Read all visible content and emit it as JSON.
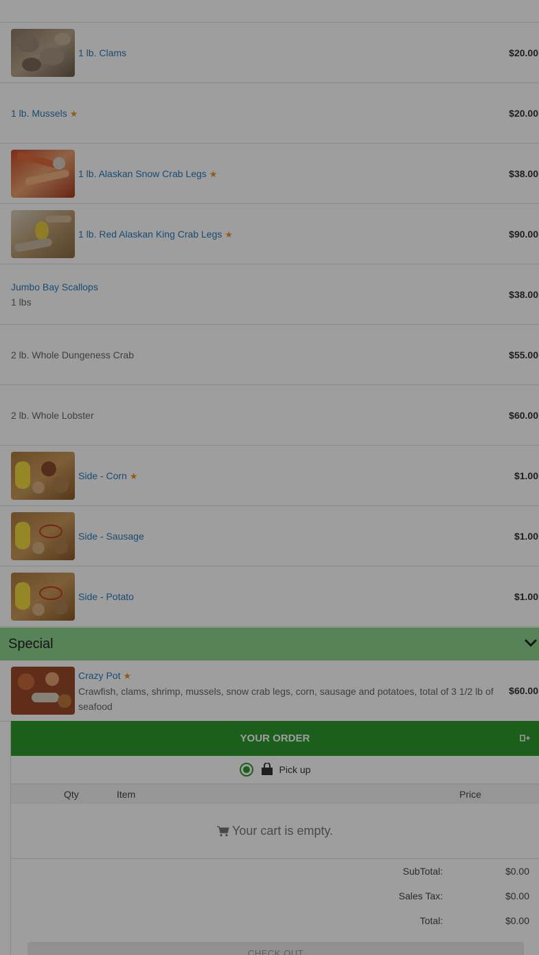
{
  "menu_items": [
    {
      "name": "1 lb. Clams",
      "price": "$20.00",
      "star": false,
      "image": "clams-photo"
    },
    {
      "name": "1 lb. Mussels",
      "price": "$20.00",
      "star": true,
      "image": ""
    },
    {
      "name": "1 lb. Alaskan Snow Crab Legs",
      "price": "$38.00",
      "star": true,
      "image": "snow-crab-photo"
    },
    {
      "name": "1 lb. Red Alaskan King Crab Legs",
      "price": "$90.00",
      "star": true,
      "image": "king-crab-photo"
    },
    {
      "name": "Jumbo Bay Scallops",
      "sub": "1 lbs",
      "price": "$38.00",
      "star": false,
      "image": ""
    },
    {
      "name": "2 lb. Whole Dungeness Crab",
      "price": "$55.00",
      "star": false,
      "image": ""
    },
    {
      "name": "2 lb. Whole Lobster",
      "price": "$60.00",
      "star": false,
      "image": ""
    },
    {
      "name": "Side - Corn",
      "price": "$1.00",
      "star": true,
      "image": "boil-photo"
    },
    {
      "name": "Side - Sausage",
      "price": "$1.00",
      "star": false,
      "image": "boil-photo"
    },
    {
      "name": "Side - Potato",
      "price": "$1.00",
      "star": false,
      "image": "boil-photo"
    }
  ],
  "category": {
    "title": "Special",
    "icon": "chevron-down-icon"
  },
  "special_item": {
    "name": "Crazy Pot",
    "description": "Crawfish, clams, shrimp, mussels, snow crab legs, corn, sausage and potatoes, total of 3 1/2 lb of seafood",
    "price": "$60.00",
    "star": true
  },
  "order": {
    "header": "YOUR ORDER",
    "pickup_label": "Pick up",
    "columns": {
      "qty": "Qty",
      "item": "Item",
      "price": "Price"
    },
    "empty_message": "Your cart is empty.",
    "subtotal_label": "SubTotal:",
    "subtotal": "$0.00",
    "tax_label": "Sales Tax:",
    "tax": "$0.00",
    "total_label": "Total:",
    "total": "$0.00",
    "checkout_label": "CHECK OUT"
  },
  "colors": {
    "accent_green": "#2e9a2e",
    "category_green": "#8fd48f",
    "link_blue": "#2a7ab8",
    "star_orange": "#e8902a"
  }
}
